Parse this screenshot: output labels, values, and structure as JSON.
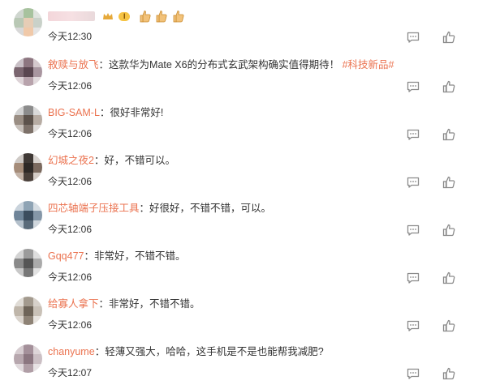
{
  "comments": [
    {
      "name": "",
      "name_hidden": true,
      "sep": "",
      "text": "",
      "vip_label": "I",
      "emoji": [
        "thumbs-up-emoji",
        "thumbs-up-emoji",
        "thumbs-up-emoji"
      ],
      "time": "今天12:30"
    },
    {
      "name": "敘赎与放飞",
      "sep": "：",
      "text": "这款华为Mate X6的分布式玄武架构确实值得期待！",
      "tag": "#科技新品#",
      "time": "今天12:06"
    },
    {
      "name": "BIG-SAM-L",
      "sep": "：",
      "text": "很好非常好!",
      "time": "今天12:06"
    },
    {
      "name": "幻城之夜2",
      "sep": "：",
      "text": "好，不错可以。",
      "time": "今天12:06"
    },
    {
      "name": "四芯轴端子压接工具",
      "sep": "：",
      "text": "好很好，不错不错，可以。",
      "time": "今天12:06"
    },
    {
      "name": "Gqq477",
      "sep": "：",
      "text": "非常好，不错不错。",
      "time": "今天12:06"
    },
    {
      "name": "给寡人拿下",
      "sep": "：",
      "text": "非常好，不错不错。",
      "time": "今天12:06"
    },
    {
      "name": "chanyume",
      "sep": "：",
      "text": "轻薄又强大，哈哈，这手机是不是也能帮我减肥?",
      "time": "今天12:07"
    }
  ],
  "icons": {
    "reply": "comment-icon",
    "like": "thumbs-up-icon"
  },
  "colors": {
    "name": "#eb7350",
    "text": "#333333",
    "icon": "#8a8a8a"
  }
}
